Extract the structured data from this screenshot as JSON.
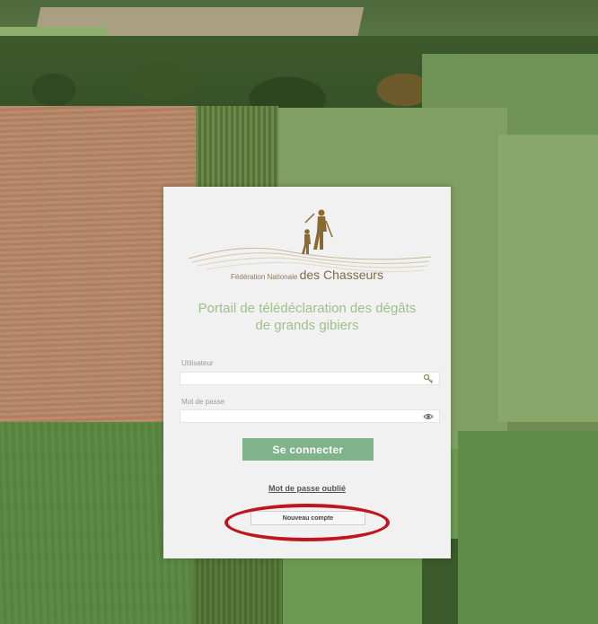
{
  "header": {
    "org_name_small": "Fédération Nationale",
    "org_name_large": "des Chasseurs"
  },
  "portal": {
    "title_line1": "Portail de télédéclaration des dégâts",
    "title_line2": "de grands gibiers"
  },
  "form": {
    "user_label": "Utilisateur",
    "user_value": "",
    "user_icon": "key-icon",
    "password_label": "Mot de passe",
    "password_value": "",
    "password_icon": "eye-icon",
    "login_button": "Se connecter",
    "forgot_link": "Mot de passe oublié",
    "new_account_button": "Nouveau compte"
  },
  "colors": {
    "primary_button": "#7fb48a",
    "title": "#9fc08a",
    "brand": "#7e6c46",
    "highlight": "#c0151c"
  }
}
